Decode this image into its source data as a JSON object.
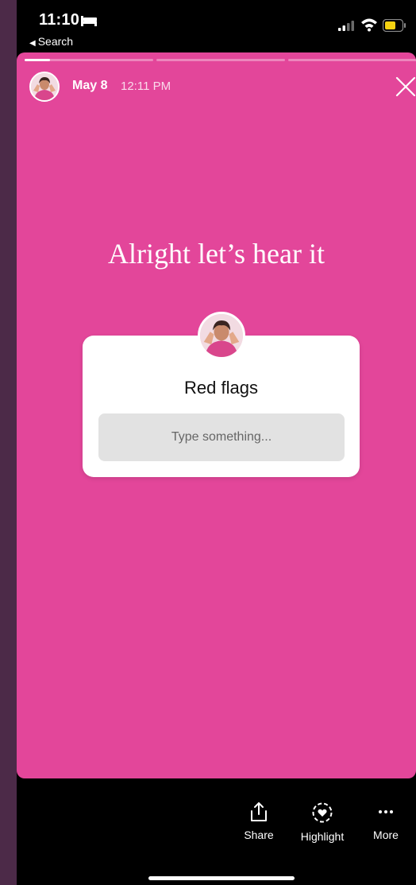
{
  "status_bar": {
    "time": "11:10",
    "back_label": "Search",
    "icons": [
      "bed-icon",
      "signal-icon",
      "wifi-icon",
      "battery-icon"
    ]
  },
  "story": {
    "background_color": "#e3469a",
    "progress_segments": 3,
    "active_segment_progress": 0.2,
    "date": "May 8",
    "time": "12:11 PM",
    "headline": "Alright let’s hear it"
  },
  "question_box": {
    "title": "Red flags",
    "placeholder": "Type something..."
  },
  "bottom_actions": [
    {
      "label": "Share",
      "icon": "share-icon"
    },
    {
      "label": "Highlight",
      "icon": "highlight-icon"
    },
    {
      "label": "More",
      "icon": "more-icon"
    }
  ]
}
